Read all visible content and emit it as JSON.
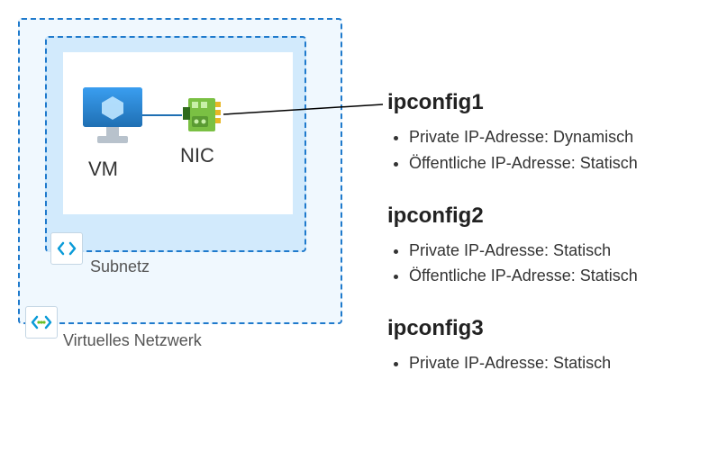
{
  "diagram": {
    "vnet_label": "Virtuelles Netzwerk",
    "subnet_label": "Subnetz",
    "vm_label": "VM",
    "nic_label": "NIC"
  },
  "configs": [
    {
      "title": "ipconfig1",
      "items": [
        "Private IP-Adresse: Dynamisch",
        "Öffentliche IP-Adresse: Statisch"
      ]
    },
    {
      "title": "ipconfig2",
      "items": [
        "Private IP-Adresse: Statisch",
        "Öffentliche IP-Adresse: Statisch"
      ]
    },
    {
      "title": "ipconfig3",
      "items": [
        "Private IP-Adresse: Statisch"
      ]
    }
  ],
  "colors": {
    "azure_blue": "#0078d4",
    "border_blue": "#1f7acc",
    "nic_green": "#7ac043"
  }
}
